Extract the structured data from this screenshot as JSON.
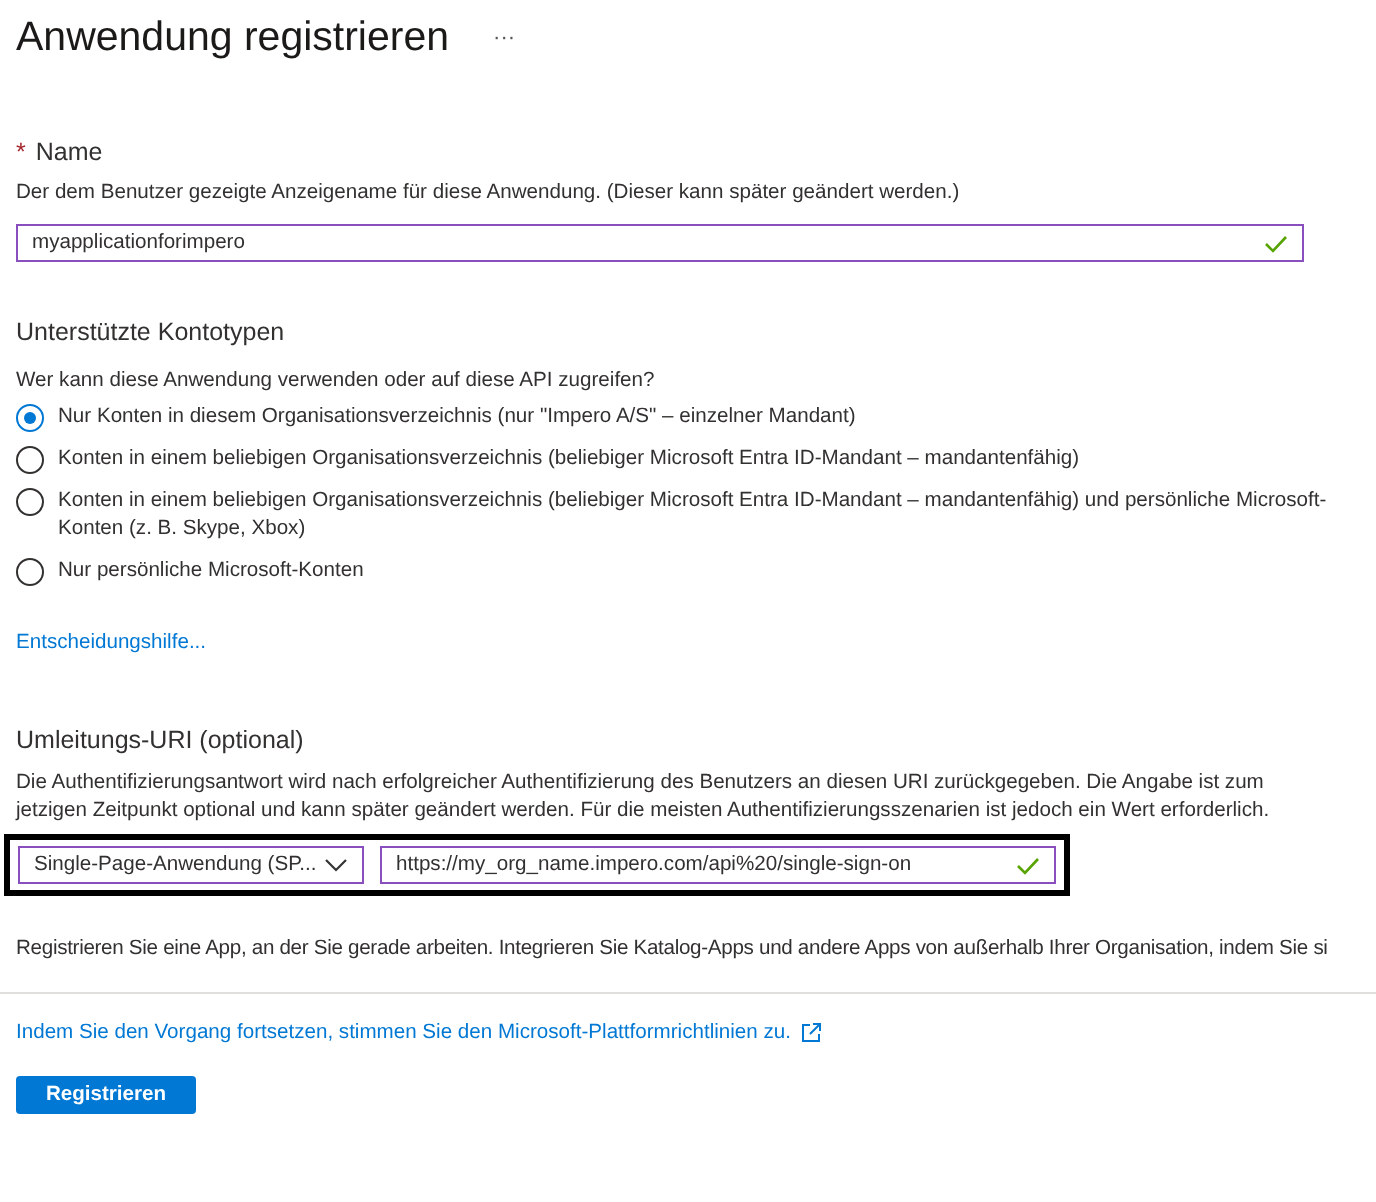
{
  "page": {
    "title": "Anwendung registrieren",
    "more": "···"
  },
  "name_section": {
    "required_mark": "*",
    "label": "Name",
    "description": "Der dem Benutzer gezeigte Anzeigename für diese Anwendung. (Dieser kann später geändert werden.)",
    "value": "myapplicationforimpero",
    "valid": true
  },
  "account_types": {
    "heading": "Unterstützte Kontotypen",
    "question": "Wer kann diese Anwendung verwenden oder auf diese API zugreifen?",
    "options": [
      {
        "label": "Nur Konten in diesem Organisationsverzeichnis (nur \"Impero A/S\" – einzelner Mandant)",
        "selected": true
      },
      {
        "label": "Konten in einem beliebigen Organisationsverzeichnis (beliebiger Microsoft Entra ID-Mandant – mandantenfähig)",
        "selected": false
      },
      {
        "label": "Konten in einem beliebigen Organisationsverzeichnis (beliebiger Microsoft Entra ID-Mandant – mandantenfähig) und persönliche Microsoft-Konten (z. B. Skype, Xbox)",
        "selected": false
      },
      {
        "label": "Nur persönliche Microsoft-Konten",
        "selected": false
      }
    ],
    "help_link": "Entscheidungshilfe..."
  },
  "redirect": {
    "heading": "Umleitungs-URI (optional)",
    "description": "Die Authentifizierungsantwort wird nach erfolgreicher Authentifizierung des Benutzers an diesen URI zurückgegeben. Die Angabe ist zum jetzigen Zeitpunkt optional und kann später geändert werden. Für die meisten Authentifizierungsszenarien ist jedoch ein Wert erforderlich.",
    "platform": "Single-Page-Anwendung (SP...",
    "uri": "https://my_org_name.impero.com/api%20/single-sign-on",
    "valid": true,
    "highlighted": true
  },
  "info": "Registrieren Sie eine App, an der Sie gerade arbeiten. Integrieren Sie Katalog-Apps und andere Apps von außerhalb Ihrer Organisation, indem Sie si",
  "footer": {
    "policy_link": "Indem Sie den Vorgang fortsetzen, stimmen Sie den Microsoft-Plattformrichtlinien zu.",
    "button": "Registrieren"
  }
}
